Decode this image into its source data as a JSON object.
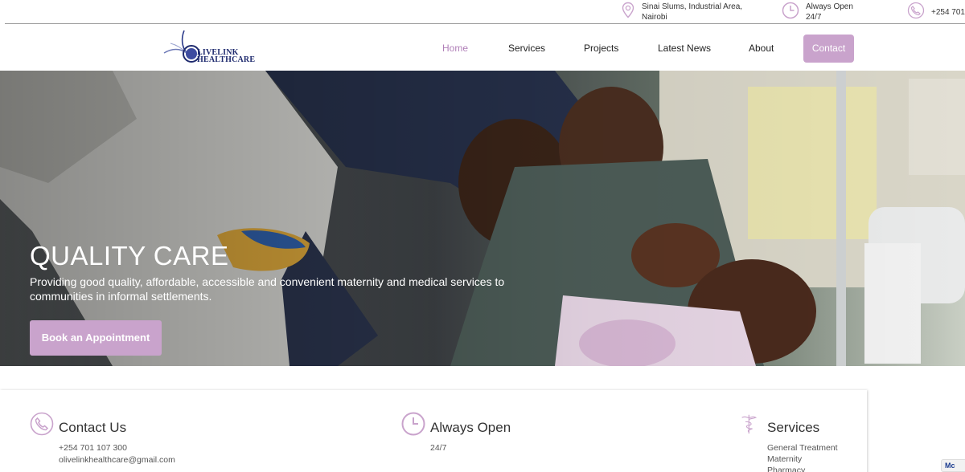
{
  "topbar": {
    "location_line1": "Sinai Slums, Industrial Area,",
    "location_line2": "Nairobi",
    "hours_line1": "Always Open",
    "hours_line2": "24/7",
    "phone": "+254 701",
    "icons": [
      "location-pin-icon",
      "clock-icon",
      "phone-icon"
    ]
  },
  "brand": {
    "name_line1": "LIVELINK",
    "name_line2": "HEALTHCARE"
  },
  "nav": {
    "home": "Home",
    "services": "Services",
    "projects": "Projects",
    "news": "Latest News",
    "about": "About",
    "contact": "Contact"
  },
  "hero": {
    "title": "QUALITY CARE",
    "description": "Providing good quality, affordable, accessible and convenient maternity and medical services to communities in informal settlements.",
    "button": "Book an Appointment"
  },
  "cards": {
    "contact": {
      "title": "Contact Us",
      "phone": "+254 701 107 300",
      "email": "olivelinkhealthcare@gmail.com"
    },
    "hours": {
      "title": "Always Open",
      "value": "24/7"
    },
    "services": {
      "title": "Services",
      "items": [
        "General Treatment",
        "Maternity",
        "Pharmacy"
      ]
    }
  },
  "badge": {
    "label": "Mc"
  },
  "colors": {
    "accent": "#c9a3cc",
    "nav_active": "#b07fb8",
    "logo_navy": "#1e2a6e"
  }
}
